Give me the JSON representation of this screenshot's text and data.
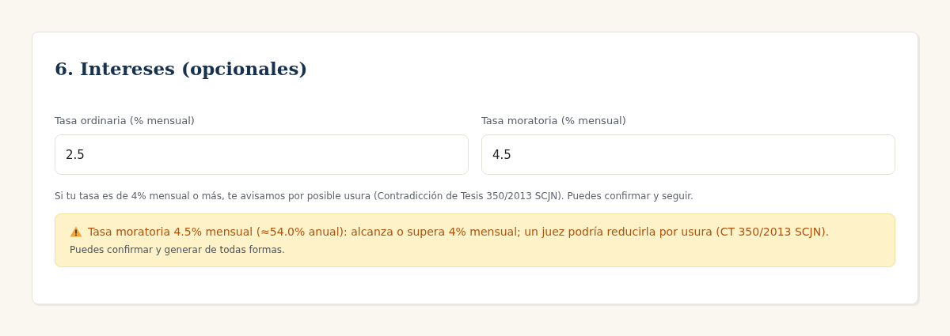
{
  "section": {
    "title": "6. Intereses (opcionales)"
  },
  "fields": [
    {
      "label": "Tasa ordinaria (% mensual)",
      "value": "2.5"
    },
    {
      "label": "Tasa moratoria (% mensual)",
      "value": "4.5"
    }
  ],
  "hint": "Si tu tasa es de 4% mensual o más, te avisamos por posible usura (Contradicción de Tesis 350/2013 SCJN). Puedes confirmar y seguir.",
  "alert": {
    "kind": "warning",
    "message": "Tasa moratoria 4.5% mensual (≈54.0% anual): alcanza o supera 4% mensual; un juez podría reducirla por usura (CT 350/2013 SCJN).",
    "note": "Puedes confirmar y generar de todas formas."
  }
}
